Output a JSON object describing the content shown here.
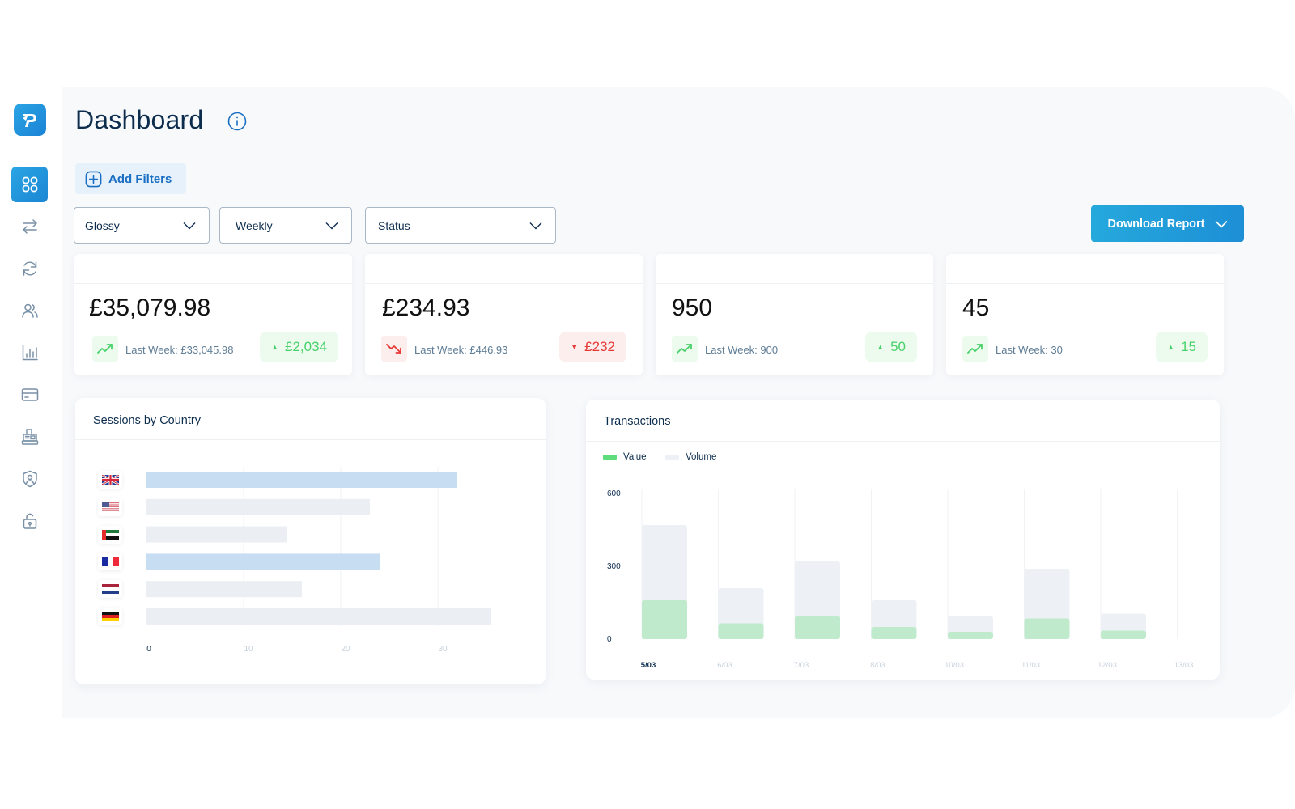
{
  "sidebar": {
    "logo": "TP",
    "items": [
      {
        "name": "dashboard",
        "icon": "grid-icon",
        "active": true
      },
      {
        "name": "transfers",
        "icon": "transfer-arrows-icon",
        "active": false
      },
      {
        "name": "recurring",
        "icon": "refresh-icon",
        "active": false
      },
      {
        "name": "customers",
        "icon": "users-icon",
        "active": false
      },
      {
        "name": "reports",
        "icon": "bar-chart-icon",
        "active": false
      },
      {
        "name": "cards",
        "icon": "credit-card-icon",
        "active": false
      },
      {
        "name": "pos",
        "icon": "cash-register-icon",
        "active": false
      },
      {
        "name": "security",
        "icon": "shield-user-icon",
        "active": false
      },
      {
        "name": "lock",
        "icon": "unlock-icon",
        "active": false
      }
    ]
  },
  "header": {
    "title": "Dashboard",
    "info_icon": "info-icon"
  },
  "filters": {
    "add_label": "Add Filters",
    "selects": [
      {
        "value": "Glossy"
      },
      {
        "value": "Weekly"
      },
      {
        "value": "Status"
      }
    ],
    "download_label": "Download Report"
  },
  "stats": [
    {
      "value": "£35,079.98",
      "last_week": "Last Week: £33,045.98",
      "delta": "£2,034",
      "direction": "up"
    },
    {
      "value": "£234.93",
      "last_week": "Last Week: £446.93",
      "delta": "£232",
      "direction": "down"
    },
    {
      "value": "950",
      "last_week": "Last Week: 900",
      "delta": "50",
      "direction": "up"
    },
    {
      "value": "45",
      "last_week": "Last Week: 30",
      "delta": "15",
      "direction": "up"
    }
  ],
  "colors": {
    "accent": "#1d8fd6",
    "up": "#48d16a",
    "down": "#e53935",
    "value_bar": "#bfeacc",
    "volume_bar": "#edf1f5",
    "country_highlight": "#c6ddf2",
    "country_normal": "#ebeef2"
  },
  "chart_data": [
    {
      "type": "bar",
      "orientation": "horizontal",
      "title": "Sessions by Country",
      "categories": [
        "United Kingdom",
        "United States",
        "United Arab Emirates",
        "France",
        "Netherlands",
        "Germany"
      ],
      "flags": [
        "gb",
        "us",
        "ae",
        "fr",
        "nl",
        "de"
      ],
      "values": [
        32,
        23,
        14.5,
        24,
        16,
        35.5
      ],
      "highlighted": [
        true,
        false,
        false,
        true,
        false,
        false
      ],
      "xticks": [
        "0",
        "10",
        "20",
        "30"
      ],
      "xlim": [
        0,
        40
      ],
      "grid": true
    },
    {
      "type": "bar",
      "title": "Transactions",
      "categories": [
        "5/03",
        "6/03",
        "7/03",
        "8/03",
        "10/03",
        "11/03",
        "12/03",
        "13/03"
      ],
      "series": [
        {
          "name": "Value",
          "values": [
            160,
            65,
            95,
            50,
            30,
            85,
            35,
            0
          ]
        },
        {
          "name": "Volume",
          "values": [
            470,
            210,
            320,
            160,
            95,
            290,
            105,
            0
          ]
        }
      ],
      "yticks": [
        "0",
        "300",
        "600"
      ],
      "ylim": [
        0,
        600
      ],
      "legend": "top-left",
      "grid": true
    }
  ]
}
